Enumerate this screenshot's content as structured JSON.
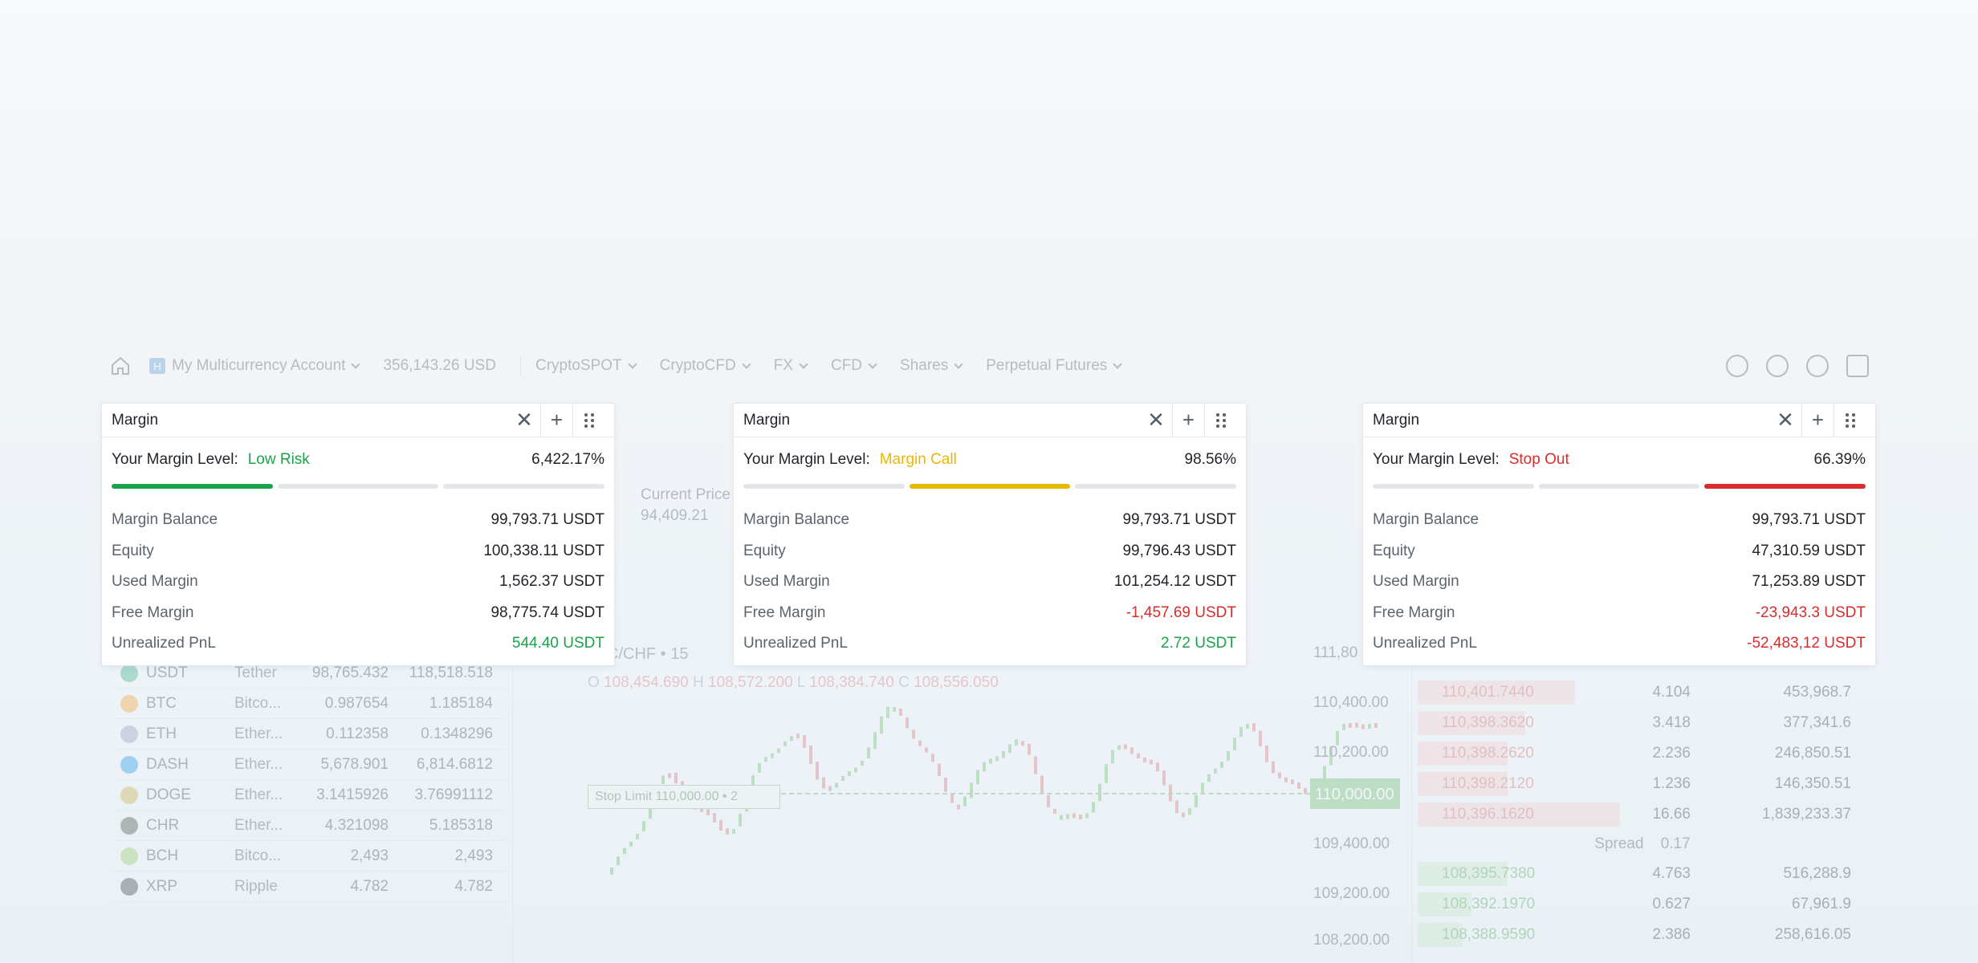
{
  "topbar": {
    "account_badge": "H",
    "account": "My Multicurrency Account",
    "balance": "356,143.26 USD",
    "menus": [
      "CryptoSPOT",
      "CryptoCFD",
      "FX",
      "CFD",
      "Shares",
      "Perpetual Futures"
    ]
  },
  "background": {
    "current_price_label": "Current Price",
    "current_price": "94,409.21",
    "pair": "C/CHF • 15",
    "ohlc": {
      "o_label": "O",
      "o": "108,454.690",
      "h_label": "H",
      "h": "108,572.200",
      "l_label": "L",
      "l": "108,384.740",
      "c_label": "C",
      "c": "108,556.050"
    },
    "stop_limit": "Stop Limit  110,000.00 • 2",
    "price_tag": "110,000.00",
    "y_labels": [
      "111,80",
      "110,400.00",
      "110,200.00",
      "109,400.00",
      "109,200.00",
      "108,200.00"
    ],
    "coins": [
      {
        "sym": "USDT",
        "net": "Tether",
        "v1": "98,765.432",
        "v2": "118,518.518",
        "color": "#26a17b"
      },
      {
        "sym": "BTC",
        "net": "Bitco...",
        "v1": "0.987654",
        "v2": "1.185184",
        "color": "#f7931a"
      },
      {
        "sym": "ETH",
        "net": "Ether...",
        "v1": "0.112358",
        "v2": "0.1348296",
        "color": "#8a92b2"
      },
      {
        "sym": "DASH",
        "net": "Ether...",
        "v1": "5,678.901",
        "v2": "6,814.6812",
        "color": "#008ce7"
      },
      {
        "sym": "DOGE",
        "net": "Ether...",
        "v1": "3.1415926",
        "v2": "3.76991112",
        "color": "#c2a633"
      },
      {
        "sym": "CHR",
        "net": "Ether...",
        "v1": "4.321098",
        "v2": "5.185318",
        "color": "#333333"
      },
      {
        "sym": "BCH",
        "net": "Bitco...",
        "v1": "2,493",
        "v2": "2,493",
        "color": "#8dc351"
      },
      {
        "sym": "XRP",
        "net": "Ripple",
        "v1": "4.782",
        "v2": "4.782",
        "color": "#23292f"
      }
    ],
    "orderbook": {
      "asks": [
        {
          "p": "110,401.7440",
          "q": "4.104",
          "t": "453,968.7"
        },
        {
          "p": "110,398.3620",
          "q": "3.418",
          "t": "377,341.6"
        },
        {
          "p": "110,398.2620",
          "q": "2.236",
          "t": "246,850.51"
        },
        {
          "p": "110,398.2120",
          "q": "1.236",
          "t": "146,350.51"
        },
        {
          "p": "110,396.1620",
          "q": "16.66",
          "t": "1,839,233.37"
        }
      ],
      "spread_label": "Spread",
      "spread": "0.17",
      "bids": [
        {
          "p": "108,395.7380",
          "q": "4.763",
          "t": "516,288.9"
        },
        {
          "p": "108,392.1970",
          "q": "0.627",
          "t": "67,961.9"
        },
        {
          "p": "108,388.9590",
          "q": "2.386",
          "t": "258,616.05"
        }
      ]
    }
  },
  "panels": [
    {
      "title": "Margin",
      "level_label": "Your Margin Level:",
      "status": "Low Risk",
      "status_color": "#1aa34a",
      "level": "6,422.17%",
      "active_segment": 0,
      "rows": {
        "margin_balance": {
          "label": "Margin Balance",
          "value": "99,793.71 USDT"
        },
        "equity": {
          "label": "Equity",
          "value": "100,338.11 USDT"
        },
        "used_margin": {
          "label": "Used Margin",
          "value": "1,562.37 USDT"
        },
        "free_margin": {
          "label": "Free Margin",
          "value": "98,775.74 USDT"
        },
        "unrealized_pnl": {
          "label": "Unrealized PnL",
          "value": "544.40 USDT"
        }
      }
    },
    {
      "title": "Margin",
      "level_label": "Your Margin Level:",
      "status": "Margin Call",
      "status_color": "#e8b800",
      "level": "98.56%",
      "active_segment": 1,
      "rows": {
        "margin_balance": {
          "label": "Margin Balance",
          "value": "99,793.71 USDT"
        },
        "equity": {
          "label": "Equity",
          "value": "99,796.43 USDT"
        },
        "used_margin": {
          "label": "Used Margin",
          "value": "101,254.12 USDT"
        },
        "free_margin": {
          "label": "Free Margin",
          "value": "-1,457.69 USDT"
        },
        "unrealized_pnl": {
          "label": "Unrealized PnL",
          "value": "2.72 USDT"
        }
      }
    },
    {
      "title": "Margin",
      "level_label": "Your Margin Level:",
      "status": "Stop Out",
      "status_color": "#d92d2d",
      "level": "66.39%",
      "active_segment": 2,
      "rows": {
        "margin_balance": {
          "label": "Margin Balance",
          "value": "99,793.71 USDT"
        },
        "equity": {
          "label": "Equity",
          "value": "47,310.59 USDT"
        },
        "used_margin": {
          "label": "Used Margin",
          "value": "71,253.89 USDT"
        },
        "free_margin": {
          "label": "Free Margin",
          "value": "-23,943.3 USDT"
        },
        "unrealized_pnl": {
          "label": "Unrealized PnL",
          "value": "-52,483,12 USDT"
        }
      }
    }
  ]
}
